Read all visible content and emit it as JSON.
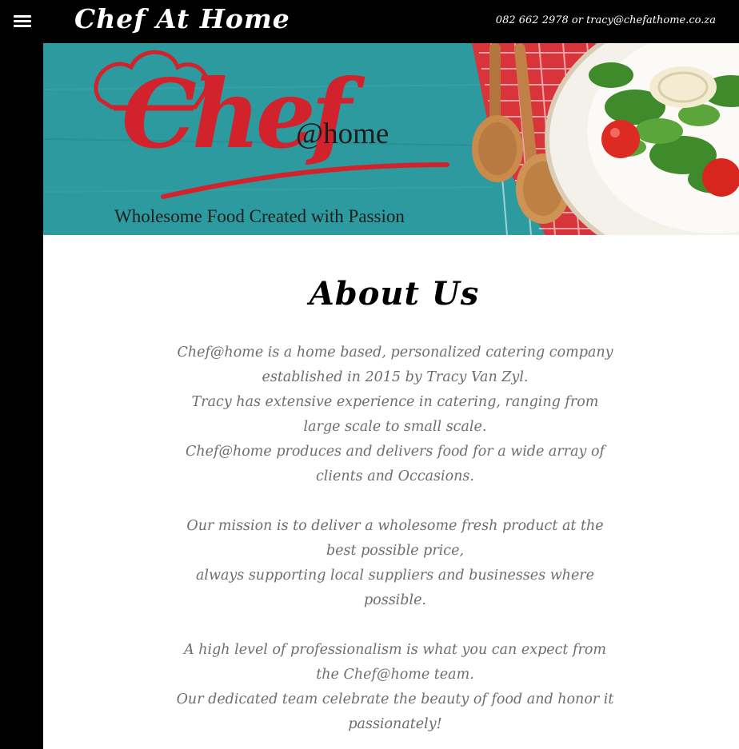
{
  "header": {
    "menu_icon": "hamburger-menu-icon",
    "site_title": "Chef At Home",
    "contact": "082 662 2978 or tracy@chefathome.co.za"
  },
  "banner": {
    "logo_word": "Chef",
    "logo_suffix": "@home",
    "tagline": "Wholesome Food Created with Passion",
    "colors": {
      "background": "#2e9ea3",
      "logo": "#d2222b"
    }
  },
  "about": {
    "title": "About Us",
    "paragraphs": [
      "Chef@home is a home based, personalized catering company established in 2015 by Tracy Van Zyl.",
      "Tracy has extensive experience in catering, ranging from large scale to small scale.",
      "Chef@home produces and delivers food for a wide array of clients and Occasions.",
      "Our mission is to deliver a wholesome fresh product at the best possible price,",
      "always supporting local suppliers and businesses where possible.",
      "A high level of professionalism is what you can expect from the Chef@home team.",
      "Our dedicated team celebrate the beauty of food and honor it passionately!"
    ]
  }
}
